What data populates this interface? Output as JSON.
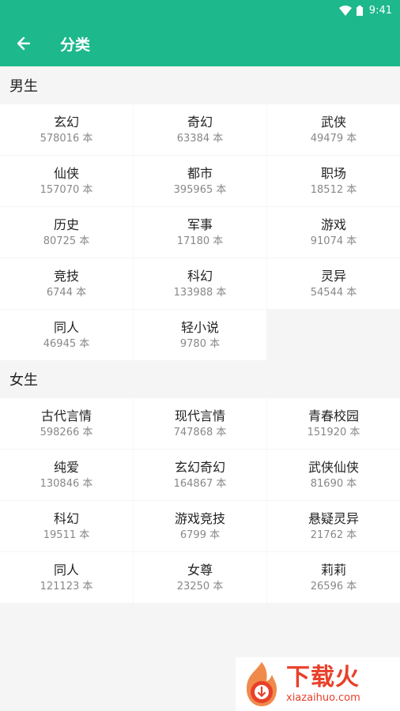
{
  "status_bar": {
    "time": "9:41"
  },
  "app_bar": {
    "title": "分类",
    "back_icon": "arrow-left-icon"
  },
  "sections": {
    "male": {
      "title": "男生",
      "items": [
        {
          "name": "玄幻",
          "count": "578016 本"
        },
        {
          "name": "奇幻",
          "count": "63384 本"
        },
        {
          "name": "武侠",
          "count": "49479 本"
        },
        {
          "name": "仙侠",
          "count": "157070 本"
        },
        {
          "name": "都市",
          "count": "395965 本"
        },
        {
          "name": "职场",
          "count": "18512 本"
        },
        {
          "name": "历史",
          "count": "80725 本"
        },
        {
          "name": "军事",
          "count": "17180 本"
        },
        {
          "name": "游戏",
          "count": "91074 本"
        },
        {
          "name": "竞技",
          "count": "6744 本"
        },
        {
          "name": "科幻",
          "count": "133988 本"
        },
        {
          "name": "灵异",
          "count": "54544 本"
        },
        {
          "name": "同人",
          "count": "46945 本"
        },
        {
          "name": "轻小说",
          "count": "9780 本"
        }
      ]
    },
    "female": {
      "title": "女生",
      "items": [
        {
          "name": "古代言情",
          "count": "598266 本"
        },
        {
          "name": "现代言情",
          "count": "747868 本"
        },
        {
          "name": "青春校园",
          "count": "151920 本"
        },
        {
          "name": "纯爱",
          "count": "130846 本"
        },
        {
          "name": "玄幻奇幻",
          "count": "164867 本"
        },
        {
          "name": "武侠仙侠",
          "count": "81690 本"
        },
        {
          "name": "科幻",
          "count": "19511 本"
        },
        {
          "name": "游戏竞技",
          "count": "6799 本"
        },
        {
          "name": "悬疑灵异",
          "count": "21762 本"
        },
        {
          "name": "同人",
          "count": "121123 本"
        },
        {
          "name": "女尊",
          "count": "23250 本"
        },
        {
          "name": "莉莉",
          "count": "26596 本"
        }
      ]
    }
  },
  "watermark": {
    "big": "下载火",
    "small": "xiazaihuo.com"
  },
  "colors": {
    "accent": "#1db88c",
    "watermark": "#e8402a"
  }
}
